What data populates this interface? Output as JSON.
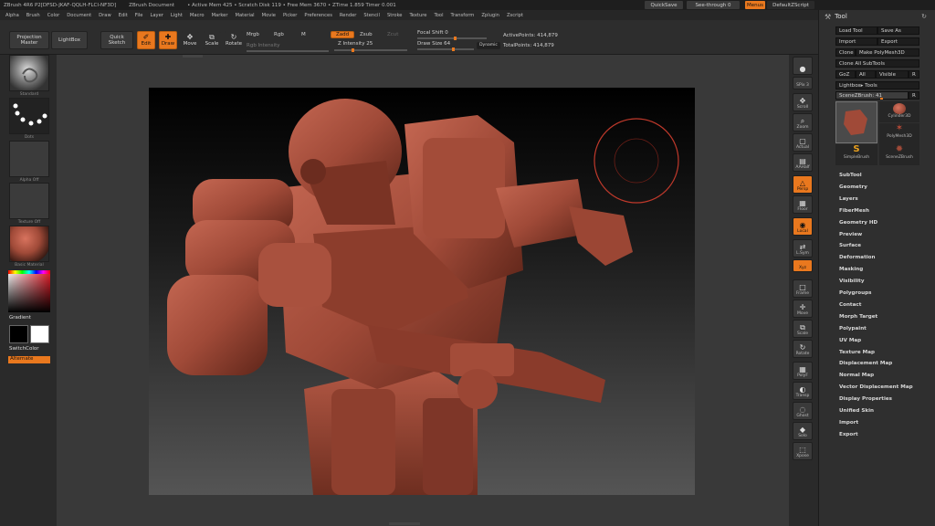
{
  "titlebar": {
    "items": [
      "ZBrush 4R6  P2[DFSD-JKAF-QQLH-FLCI-NF3D]",
      "ZBrush Document",
      "• Active Mem 425 • Scratch Disk 119 • Free Mem 3670 • ZTime 1.859 Timer 0.001"
    ],
    "quicksave": "QuickSave",
    "seethrough": "See-through",
    "seethrough_value": "0",
    "menus": "Menus",
    "defaultzscript": "DefaultZScript"
  },
  "menubar": [
    "Alpha",
    "Brush",
    "Color",
    "Document",
    "Draw",
    "Edit",
    "File",
    "Layer",
    "Light",
    "Macro",
    "Marker",
    "Material",
    "Movie",
    "Picker",
    "Preferences",
    "Render",
    "Stencil",
    "Stroke",
    "Texture",
    "Tool",
    "Transform",
    "Zplugin",
    "Zscript"
  ],
  "toolbar": {
    "projection_master": "Projection Master",
    "lightbox": "LightBox",
    "quick_sketch": "Quick Sketch",
    "edit": "Edit",
    "draw": "Draw",
    "move": "Move",
    "scale": "Scale",
    "rotate": "Rotate",
    "mrgb": "Mrgb",
    "rgb": "Rgb",
    "m": "M",
    "rgb_intensity": "Rgb Intensity",
    "zadd": "Zadd",
    "zsub": "Zsub",
    "zcut": "Zcut",
    "z_intensity": "Z Intensity 25",
    "z_intensity_value": 25,
    "focal_shift": "Focal Shift 0",
    "draw_size": "Draw Size 64",
    "draw_size_value": 64,
    "dynamic": "Dynamic",
    "active_points": "ActivePoints: 414,879",
    "total_points": "TotalPoints: 414,879"
  },
  "leftshelf": {
    "brush_label": "Standard",
    "stroke_label": "Dots",
    "alpha_label": "Alpha Off",
    "texture_label": "Texture Off",
    "material_label": "Basic Material",
    "gradient": "Gradient",
    "switchcolor": "SwitchColor",
    "alternate": "Alternate"
  },
  "rightshelf": [
    {
      "label": "",
      "icon": "sphere-icon"
    },
    {
      "label": "SPix 3",
      "icon": "spix-icon"
    },
    {
      "label": "Scroll",
      "icon": "scroll-icon"
    },
    {
      "label": "Zoom",
      "icon": "zoom-icon"
    },
    {
      "label": "Actual",
      "icon": "actual-icon"
    },
    {
      "label": "AAHalf",
      "icon": "aahalf-icon"
    },
    {
      "label": "Persp",
      "icon": "persp-icon"
    },
    {
      "label": "Floor",
      "icon": "floor-icon"
    },
    {
      "label": "Local",
      "icon": "local-icon"
    },
    {
      "label": "L.Sym",
      "icon": "lsym-icon"
    },
    {
      "label": "Xyz",
      "icon": "xyz-icon"
    },
    {
      "label": "Frame",
      "icon": "frame-icon"
    },
    {
      "label": "Move",
      "icon": "move-icon"
    },
    {
      "label": "Scale",
      "icon": "scale-icon"
    },
    {
      "label": "Rotate",
      "icon": "rotate-icon"
    },
    {
      "label": "PolyF",
      "icon": "polyf-icon"
    },
    {
      "label": "Transp",
      "icon": "transp-icon"
    },
    {
      "label": "Ghost",
      "icon": "ghost-icon"
    },
    {
      "label": "Solo",
      "icon": "solo-icon"
    },
    {
      "label": "Xpose",
      "icon": "xpose-icon"
    }
  ],
  "toolpanel": {
    "title": "Tool",
    "load_tool": "Load Tool",
    "save_as": "Save As",
    "import": "Import",
    "export": "Export",
    "clone": "Clone",
    "make_polymesh": "Make PolyMesh3D",
    "clone_all": "Clone All SubTools",
    "goz": "GoZ",
    "all": "All",
    "visible": "Visible",
    "r": "R",
    "lightbox_tools": "Lightbox▸ Tools",
    "scene_brush": "SceneZBrush: 41",
    "scene_brush_value": 41,
    "thumbs": [
      "Cylinder3D",
      "PolyMesh3D",
      "SimpleBrush",
      "SceneZBrush"
    ],
    "menu": [
      "SubTool",
      "Geometry",
      "Layers",
      "FiberMesh",
      "Geometry HD",
      "Preview",
      "Surface",
      "Deformation",
      "Masking",
      "Visibility",
      "Polygroups",
      "Contact",
      "Morph Target",
      "Polypaint",
      "UV Map",
      "Texture Map",
      "Displacement Map",
      "Normal Map",
      "Vector Displacement Map",
      "Display Properties",
      "Unified Skin",
      "Import",
      "Export"
    ]
  },
  "colors": {
    "accent": "#e9781e",
    "model": "#a04a38"
  }
}
